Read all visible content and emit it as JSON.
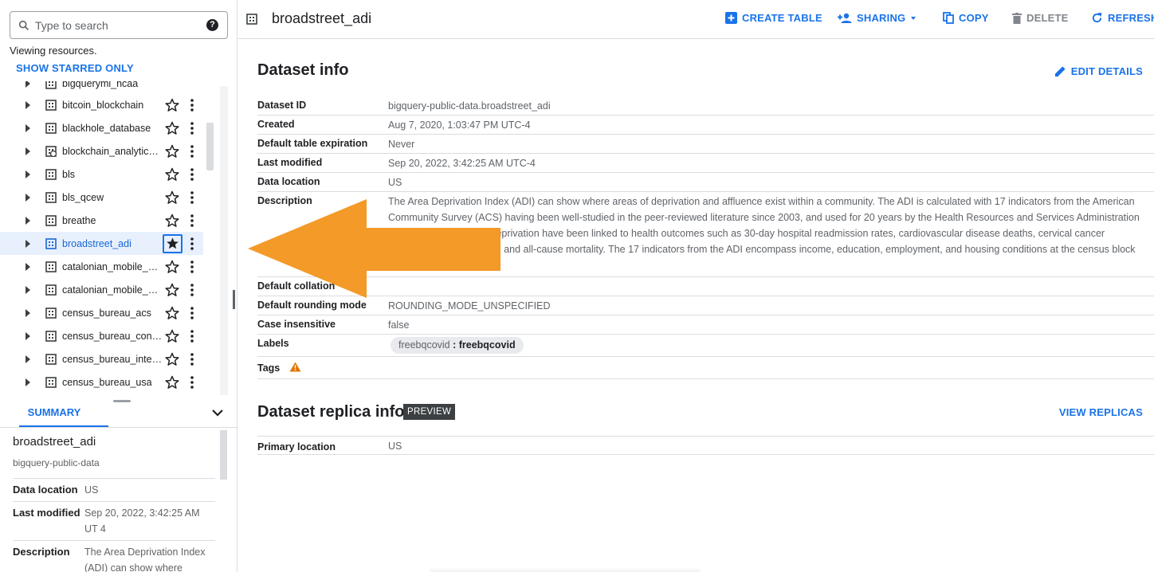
{
  "search": {
    "placeholder": "Type to search"
  },
  "explorer": {
    "viewing_text": "Viewing resources.",
    "show_starred": "SHOW STARRED ONLY",
    "partial_item": "bigqueryml_ncaa",
    "items": [
      {
        "label": "bitcoin_blockchain",
        "icon": "dataset-icon",
        "starred": false,
        "selected": false
      },
      {
        "label": "blackhole_database",
        "icon": "dataset-icon",
        "starred": false,
        "selected": false
      },
      {
        "label": "blockchain_analytics_...",
        "icon": "linked-dataset-icon",
        "starred": false,
        "selected": false
      },
      {
        "label": "bls",
        "icon": "dataset-icon",
        "starred": false,
        "selected": false
      },
      {
        "label": "bls_qcew",
        "icon": "dataset-icon",
        "starred": false,
        "selected": false
      },
      {
        "label": "breathe",
        "icon": "dataset-icon",
        "starred": false,
        "selected": false
      },
      {
        "label": "broadstreet_adi",
        "icon": "dataset-icon",
        "starred": true,
        "selected": true
      },
      {
        "label": "catalonian_mobile_co...",
        "icon": "dataset-icon",
        "starred": false,
        "selected": false
      },
      {
        "label": "catalonian_mobile_co...",
        "icon": "dataset-icon",
        "starred": false,
        "selected": false
      },
      {
        "label": "census_bureau_acs",
        "icon": "dataset-icon",
        "starred": false,
        "selected": false
      },
      {
        "label": "census_bureau_const...",
        "icon": "dataset-icon",
        "starred": false,
        "selected": false
      },
      {
        "label": "census_bureau_intern...",
        "icon": "dataset-icon",
        "starred": false,
        "selected": false
      },
      {
        "label": "census_bureau_usa",
        "icon": "dataset-icon",
        "starred": false,
        "selected": false
      }
    ]
  },
  "summary": {
    "tab_label": "SUMMARY",
    "name": "broadstreet_adi",
    "project": "bigquery-public-data",
    "rows": [
      {
        "key": "Data location",
        "value": "US"
      },
      {
        "key": "Last modified",
        "value": "Sep 20, 2022, 3:42:25 AM UT 4"
      },
      {
        "key": "Description",
        "value": "The Area Deprivation Index (ADI) can show where"
      }
    ]
  },
  "header": {
    "title": "broadstreet_adi",
    "buttons": {
      "create_table": "CREATE TABLE",
      "sharing": "SHARING",
      "copy": "COPY",
      "delete": "DELETE",
      "refresh": "REFRESH"
    }
  },
  "dataset_info": {
    "title": "Dataset info",
    "edit_details": "EDIT DETAILS",
    "rows": {
      "dataset_id": {
        "key": "Dataset ID",
        "value": "bigquery-public-data.broadstreet_adi"
      },
      "created": {
        "key": "Created",
        "value": "Aug 7, 2020, 1:03:47 PM UTC-4"
      },
      "expiration": {
        "key": "Default table expiration",
        "value": "Never"
      },
      "last_modified": {
        "key": "Last modified",
        "value": "Sep 20, 2022, 3:42:25 AM UTC-4"
      },
      "data_location": {
        "key": "Data location",
        "value": "US"
      },
      "description": {
        "key": "Description",
        "value": "The Area Deprivation Index (ADI)  can show where areas of deprivation and affluence exist within a community. The ADI is calculated with 17 indicators from the American Community Survey (ACS) having been well-studied in the peer-reviewed literature since 2003, and used for 20 years by the Health Resources and Services Administration (HRSA). High levels of deprivation have been linked to health outcomes such as 30-day hospital readmission rates, cardiovascular disease deaths, cervical cancer incidence, cancer deaths, and all-cause mortality. The 17 indicators from the ADI encompass income, education, employment, and housing conditions at the census block group level."
      },
      "collation": {
        "key": "Default collation",
        "value": ""
      },
      "rounding": {
        "key": "Default rounding mode",
        "value": "ROUNDING_MODE_UNSPECIFIED"
      },
      "case_insensitive": {
        "key": "Case insensitive",
        "value": "false"
      },
      "labels": {
        "key": "Labels",
        "label_key": "freebqcovid",
        "label_value": "freebqcovid"
      },
      "tags": {
        "key": "Tags"
      }
    }
  },
  "replica_info": {
    "title": "Dataset replica info",
    "badge": "PREVIEW",
    "view_replicas": "VIEW REPLICAS",
    "rows": {
      "primary_location": {
        "key": "Primary location",
        "value": "US"
      }
    }
  },
  "colors": {
    "accent": "#1a73e8",
    "annotation_arrow": "#F39A28",
    "warning": "#e37400"
  }
}
